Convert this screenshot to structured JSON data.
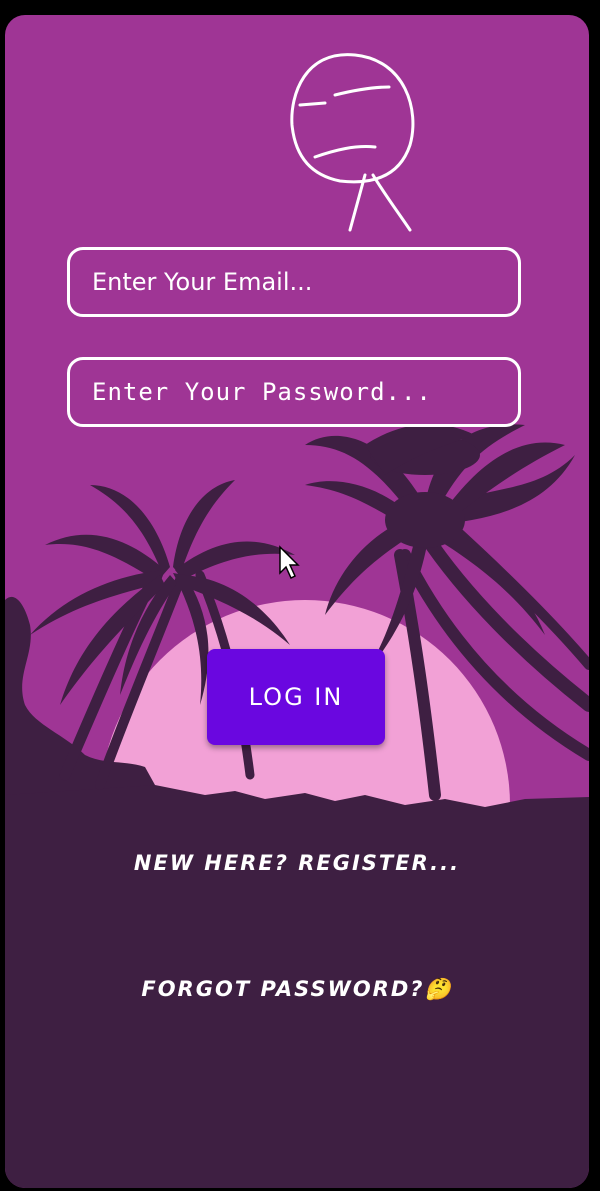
{
  "form": {
    "email_placeholder": "Enter Your Email...",
    "password_placeholder": "Enter Your Password...",
    "login_label": "LOG IN"
  },
  "links": {
    "register": "NEW HERE? REGISTER...",
    "forgot": "FORGOT PASSWORD?🤔"
  },
  "colors": {
    "sky": "#9f3595",
    "sun": "#f2a1d6",
    "silhouette": "#3e1f42",
    "button": "#6a07e0"
  },
  "icons": [
    "stick-figure-icon",
    "mouse-cursor-icon"
  ]
}
